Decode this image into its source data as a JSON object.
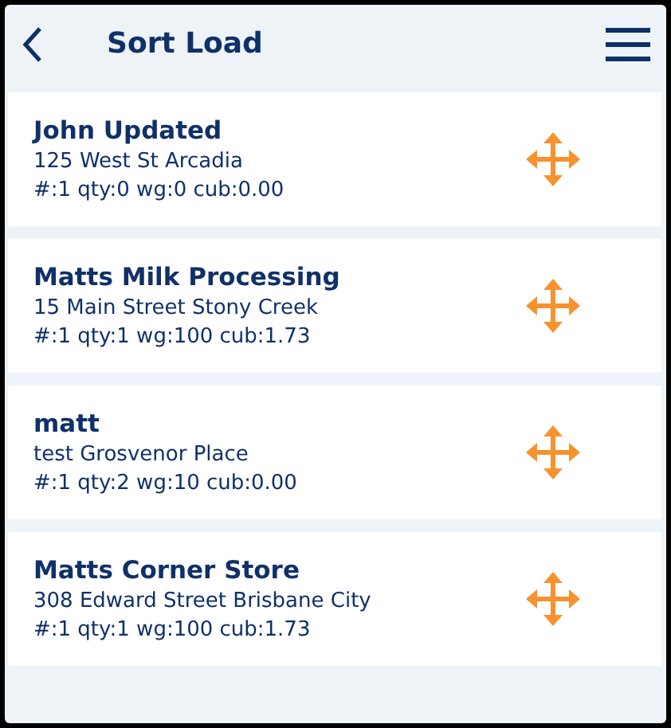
{
  "header": {
    "title": "Sort Load"
  },
  "stops": [
    {
      "name": "John Updated",
      "address": "125 West St Arcadia",
      "summary": "#:1 qty:0 wg:0 cub:0.00"
    },
    {
      "name": "Matts Milk Processing",
      "address": "15 Main Street Stony Creek",
      "summary": "#:1 qty:1 wg:100 cub:1.73"
    },
    {
      "name": "matt",
      "address": "test Grosvenor Place",
      "summary": "#:1 qty:2 wg:10 cub:0.00"
    },
    {
      "name": "Matts Corner Store",
      "address": "308 Edward Street Brisbane City",
      "summary": "#:1 qty:1 wg:100 cub:1.73"
    }
  ]
}
